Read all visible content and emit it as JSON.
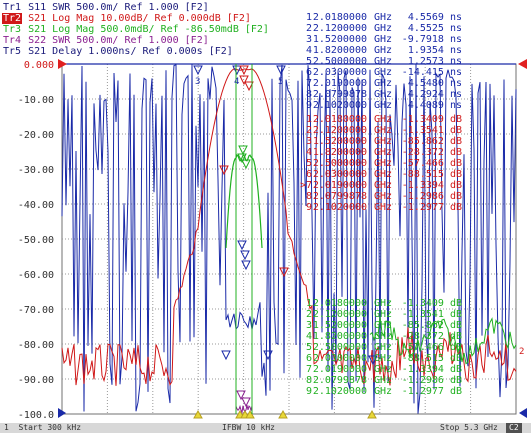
{
  "traces": [
    {
      "id": "Tr1",
      "param": "S11",
      "format": "SWR",
      "scale": "500.0m/",
      "ref": "Ref 1.000",
      "tag": "[F2]",
      "color": "#1a1a7a",
      "label_bg": "",
      "label_fg": "#1a1a7a"
    },
    {
      "id": "Tr2",
      "param": "S21",
      "format": "Log Mag",
      "scale": "10.00dB/",
      "ref": "Ref 0.000dB",
      "tag": "[F2]",
      "color": "#d01818",
      "label_bg": "#d01818",
      "label_fg": "#ffffff"
    },
    {
      "id": "Tr3",
      "param": "S21",
      "format": "Log Mag",
      "scale": "500.0mdB/",
      "ref": "Ref -86.50mdB",
      "tag": "[F2]",
      "color": "#20b020",
      "label_bg": "",
      "label_fg": "#20b020"
    },
    {
      "id": "Tr4",
      "param": "S22",
      "format": "SWR",
      "scale": "500.0m/",
      "ref": "Ref 1.000",
      "tag": "[F2]",
      "color": "#8a2090",
      "label_bg": "",
      "label_fg": "#8a2090"
    },
    {
      "id": "Tr5",
      "param": "S21",
      "format": "Delay",
      "scale": "1.000ns/",
      "ref": "Ref 0.000s",
      "tag": "[F2]",
      "color": "#1a1a7a",
      "label_bg": "",
      "label_fg": "#1a1a7a"
    }
  ],
  "y_axis": {
    "labels": [
      "0.000",
      "-10.00",
      "-20.00",
      "-30.00",
      "-40.00",
      "-50.00",
      "-60.00",
      "-70.00",
      "-80.00",
      "-90.00",
      "-100.0"
    ],
    "ref_label": "0.000"
  },
  "marker_tables": [
    {
      "trace": "Tr5",
      "color": "#1a2aa8",
      "rows": [
        {
          "n": "1",
          "freq": "2.0180000",
          "unit": "GHz",
          "value": "4.5569 ns"
        },
        {
          "n": "2",
          "freq": "2.1200000",
          "unit": "GHz",
          "value": "4.5525 ns"
        },
        {
          "n": "3",
          "freq": "1.5200000",
          "unit": "GHz",
          "value": "-9.7918 ns"
        },
        {
          "n": "4",
          "freq": "1.8200000",
          "unit": "GHz",
          "value": "1.9354 ns"
        },
        {
          "n": "5",
          "freq": "2.5000000",
          "unit": "GHz",
          "value": "1.2573 ns"
        },
        {
          "n": "6",
          "freq": "2.0300000",
          "unit": "GHz",
          "value": "-14.415 ns"
        },
        {
          "n": "7",
          "freq": "2.0190000",
          "unit": "GHz",
          "value": "4.5480 ns"
        },
        {
          "n": "8",
          "freq": "2.0799878",
          "unit": "GHz",
          "value": "4.2924 ns"
        },
        {
          "n": "9",
          "freq": "2.1020000",
          "unit": "GHz",
          "value": "4.4089 ns"
        }
      ]
    },
    {
      "trace": "Tr2",
      "color": "#d01818",
      "rows": [
        {
          "n": "1",
          "freq": "2.0180000",
          "unit": "GHz",
          "value": "-1.3409 dB"
        },
        {
          "n": "2",
          "freq": "2.1200000",
          "unit": "GHz",
          "value": "-1.3541 dB"
        },
        {
          "n": "3",
          "freq": "1.5200000",
          "unit": "GHz",
          "value": "-85.862 dB"
        },
        {
          "n": "4",
          "freq": "1.8200000",
          "unit": "GHz",
          "value": "-28.372 dB"
        },
        {
          "n": "5",
          "freq": "2.5000000",
          "unit": "GHz",
          "value": "-57.466 dB"
        },
        {
          "n": "6",
          "freq": "2.0300000",
          "unit": "GHz",
          "value": "-88.515 dB"
        },
        {
          "n": ">7",
          "freq": "2.0190000",
          "unit": "GHz",
          "value": "-1.3394 dB"
        },
        {
          "n": "8",
          "freq": "2.0799878",
          "unit": "GHz",
          "value": "-1.2986 dB"
        },
        {
          "n": "9",
          "freq": "2.1020000",
          "unit": "GHz",
          "value": "-1.2977 dB"
        }
      ]
    },
    {
      "trace": "Tr3",
      "color": "#20b020",
      "rows": [
        {
          "n": "1",
          "freq": "2.0180000",
          "unit": "GHz",
          "value": "-1.3409 dB"
        },
        {
          "n": "2",
          "freq": "2.1200000",
          "unit": "GHz",
          "value": "-1.3541 dB"
        },
        {
          "n": "3",
          "freq": "1.5200000",
          "unit": "GHz",
          "value": "-85.862 dB"
        },
        {
          "n": "4",
          "freq": "1.8200000",
          "unit": "GHz",
          "value": "-28.372 dB"
        },
        {
          "n": "5",
          "freq": "2.5000000",
          "unit": "GHz",
          "value": "-57.466 dB"
        },
        {
          "n": "6",
          "freq": "2.0300000",
          "unit": "GHz",
          "value": "-88.515 dB"
        },
        {
          "n": "7",
          "freq": "2.0190000",
          "unit": "GHz",
          "value": "-1.3394 dB"
        },
        {
          "n": "8",
          "freq": "2.0799878",
          "unit": "GHz",
          "value": "-1.2986 dB"
        },
        {
          "n": "9",
          "freq": "2.1020000",
          "unit": "GHz",
          "value": "-1.2977 dB"
        }
      ]
    }
  ],
  "status_bar": {
    "start": "1  Start 300 kHz",
    "ifbw": "IFBW 10 kHz",
    "stop": "Stop 5.3 GHz",
    "badge": "C2"
  },
  "colors": {
    "grid": "#888888",
    "plot_bg": "#ffffff",
    "ref_marker": "#e02020",
    "marker_filter_bottom": "#e8d838"
  },
  "icons": {
    "ref_left": "left-red-triangle-icon",
    "ref_right": "right-red-triangle-icon",
    "scale_bottom": "blue-triangle-icon"
  }
}
